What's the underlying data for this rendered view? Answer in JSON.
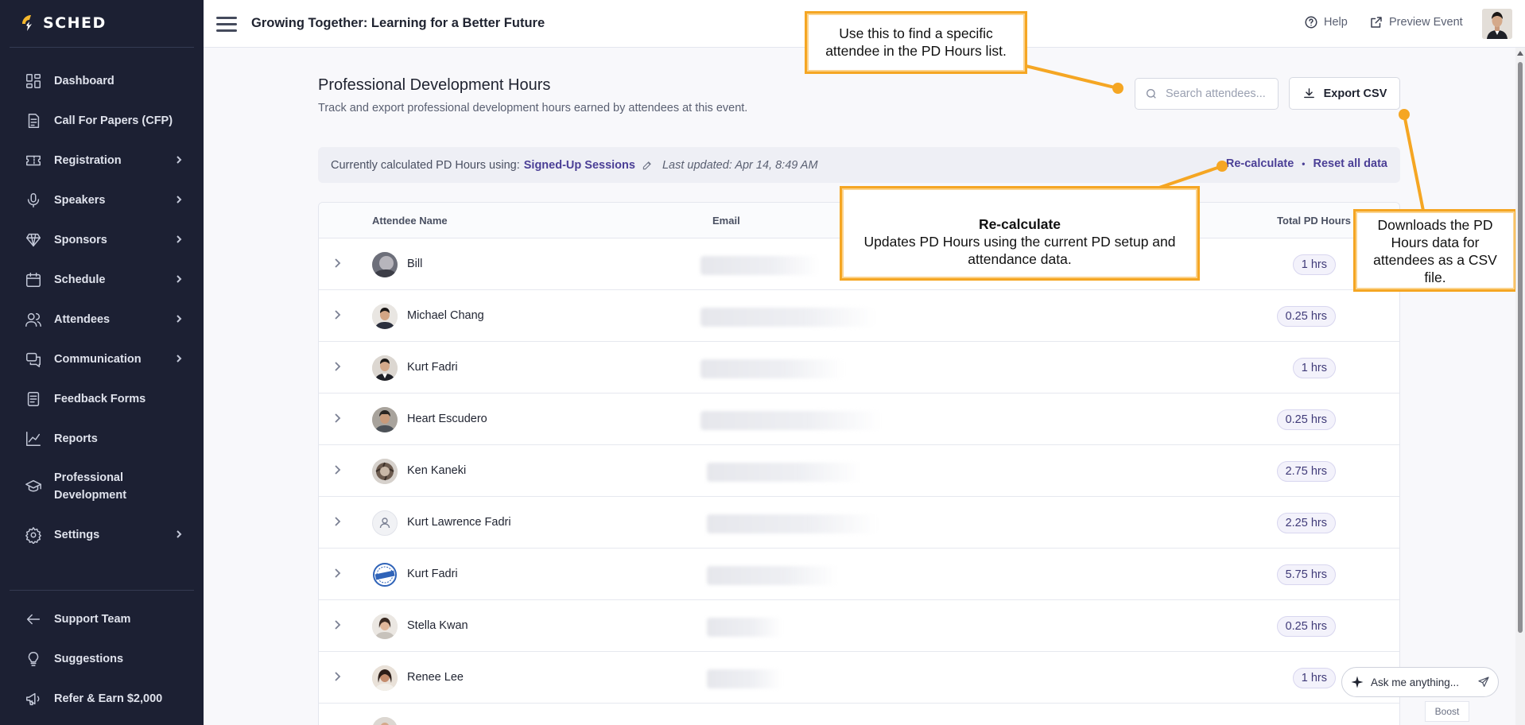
{
  "app": {
    "logo_text": "SCHED",
    "event_title": "Growing Together: Learning for a Better Future"
  },
  "sidebar": {
    "items": [
      {
        "label": "Dashboard",
        "icon": "dashboard-icon",
        "has_chevron": false
      },
      {
        "label": "Call For Papers (CFP)",
        "icon": "document-icon",
        "has_chevron": false
      },
      {
        "label": "Registration",
        "icon": "ticket-icon",
        "has_chevron": true
      },
      {
        "label": "Speakers",
        "icon": "microphone-icon",
        "has_chevron": true
      },
      {
        "label": "Sponsors",
        "icon": "diamond-icon",
        "has_chevron": true
      },
      {
        "label": "Schedule",
        "icon": "calendar-icon",
        "has_chevron": true
      },
      {
        "label": "Attendees",
        "icon": "users-icon",
        "has_chevron": true
      },
      {
        "label": "Communication",
        "icon": "chat-icon",
        "has_chevron": true
      },
      {
        "label": "Feedback Forms",
        "icon": "form-icon",
        "has_chevron": false
      },
      {
        "label": "Reports",
        "icon": "chart-line-icon",
        "has_chevron": false
      },
      {
        "label_line1": "Professional",
        "label_line2": "Development",
        "icon": "graduation-cap-icon",
        "has_chevron": false
      },
      {
        "label": "Settings",
        "icon": "gear-icon",
        "has_chevron": true
      }
    ],
    "footer_items": [
      {
        "label": "Support Team",
        "icon": "arrow-left-icon"
      },
      {
        "label": "Suggestions",
        "icon": "lightbulb-icon"
      },
      {
        "label": "Refer & Earn $2,000",
        "icon": "megaphone-icon"
      }
    ]
  },
  "topbar": {
    "help_label": "Help",
    "preview_label": "Preview Event"
  },
  "main": {
    "title": "Professional Development Hours",
    "subtitle": "Track and export professional development hours earned by attendees at this event.",
    "search_placeholder": "Search attendees...",
    "export_label": "Export CSV",
    "info": {
      "prefix": "Currently calculated PD Hours using:",
      "method": "Signed-Up Sessions",
      "updated": "Last updated: Apr 14, 8:49 AM",
      "recalculate_label": "Re-calculate",
      "separator": "•",
      "reset_label": "Reset all data"
    },
    "table": {
      "headers": {
        "name": "Attendee Name",
        "email": "Email",
        "hours": "Total PD Hours"
      },
      "rows": [
        {
          "name": "Bill",
          "hours": "1 hrs",
          "avatar": "photo"
        },
        {
          "name": "Michael Chang",
          "hours": "0.25 hrs",
          "avatar": "photo"
        },
        {
          "name": "Kurt Fadri",
          "hours": "1 hrs",
          "avatar": "photo"
        },
        {
          "name": "Heart Escudero",
          "hours": "0.25 hrs",
          "avatar": "photo"
        },
        {
          "name": "Ken Kaneki",
          "hours": "2.75 hrs",
          "avatar": "photo"
        },
        {
          "name": "Kurt Lawrence Fadri",
          "hours": "2.25 hrs",
          "avatar": "placeholder"
        },
        {
          "name": "Kurt Fadri",
          "hours": "5.75 hrs",
          "avatar": "sample-stamp"
        },
        {
          "name": "Stella Kwan",
          "hours": "0.25 hrs",
          "avatar": "photo"
        },
        {
          "name": "Renee Lee",
          "hours": "1 hrs",
          "avatar": "photo"
        }
      ]
    }
  },
  "callouts": {
    "search": "Use this to find a specific attendee in the PD Hours list.",
    "recalc_title": "Re-calculate",
    "recalc_body": "Updates PD Hours using the current PD setup and attendance data.",
    "export": "Downloads the PD Hours data for attendees as a CSV file."
  },
  "assistant": {
    "placeholder": "Ask me anything...",
    "boost_label": "Boost"
  },
  "colors": {
    "sidebar_bg": "#1c2033",
    "accent": "#4b3f96",
    "callout_border": "#f5a623",
    "page_bg": "#f8f8fb"
  }
}
